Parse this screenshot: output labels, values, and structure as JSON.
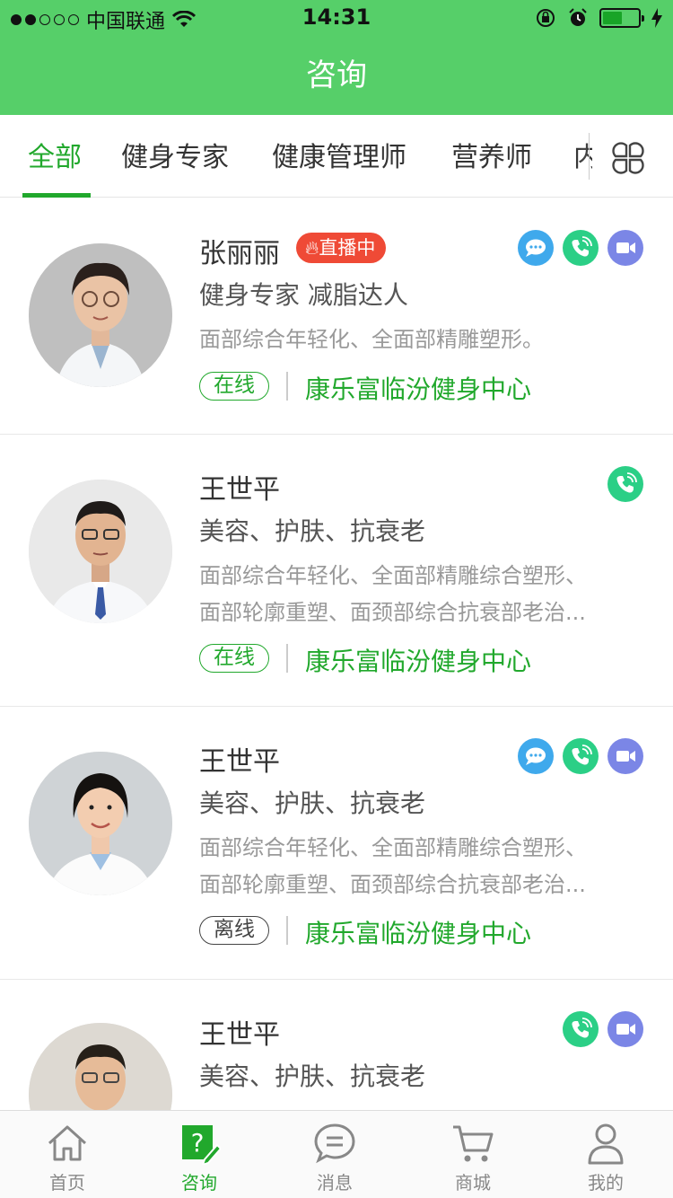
{
  "status_bar": {
    "carrier": "中国联通",
    "time": "14:31",
    "signal_filled": 2,
    "signal_total": 5,
    "battery_level": 0.55
  },
  "nav": {
    "title": "咨询"
  },
  "tabs": [
    {
      "label": "全部",
      "active": true
    },
    {
      "label": "健身专家",
      "active": false
    },
    {
      "label": "健康管理师",
      "active": false
    },
    {
      "label": "营养师",
      "active": false
    },
    {
      "label": "内",
      "active": false
    }
  ],
  "experts": [
    {
      "name": "张丽丽",
      "live_label": "直播中",
      "tags": "健身专家    减脂达人",
      "desc_lines": [
        "面部综合年轻化、全面部精雕塑形。"
      ],
      "status": "在线",
      "clinic": "康乐富临汾健身中心",
      "actions": [
        "chat",
        "phone",
        "video"
      ]
    },
    {
      "name": "王世平",
      "tags": "美容、护肤、抗衰老",
      "desc_lines": [
        "面部综合年轻化、全面部精雕综合塑形、",
        "面部轮廓重塑、面颈部综合抗衰部老治..."
      ],
      "status": "在线",
      "clinic": "康乐富临汾健身中心",
      "actions": [
        "phone"
      ]
    },
    {
      "name": "王世平",
      "tags": "美容、护肤、抗衰老",
      "desc_lines": [
        "面部综合年轻化、全面部精雕综合塑形、",
        "面部轮廓重塑、面颈部综合抗衰部老治..."
      ],
      "status": "离线",
      "clinic": "康乐富临汾健身中心",
      "actions": [
        "chat",
        "phone",
        "video"
      ]
    },
    {
      "name": "王世平",
      "tags": "美容、护肤、抗衰老",
      "desc_lines": [],
      "status": "",
      "clinic": "",
      "actions": [
        "phone",
        "video"
      ]
    }
  ],
  "tabbar": [
    {
      "label": "首页",
      "icon": "home-icon",
      "active": false
    },
    {
      "label": "咨询",
      "icon": "consult-icon",
      "active": true
    },
    {
      "label": "消息",
      "icon": "message-icon",
      "active": false
    },
    {
      "label": "商城",
      "icon": "cart-icon",
      "active": false
    },
    {
      "label": "我的",
      "icon": "profile-icon",
      "active": false
    }
  ],
  "colors": {
    "brand": "#56cf69",
    "accent": "#21a82c",
    "live": "#ef4a36",
    "chat": "#3fa9ec",
    "phone": "#2bcf86",
    "video": "#7b86e6"
  }
}
